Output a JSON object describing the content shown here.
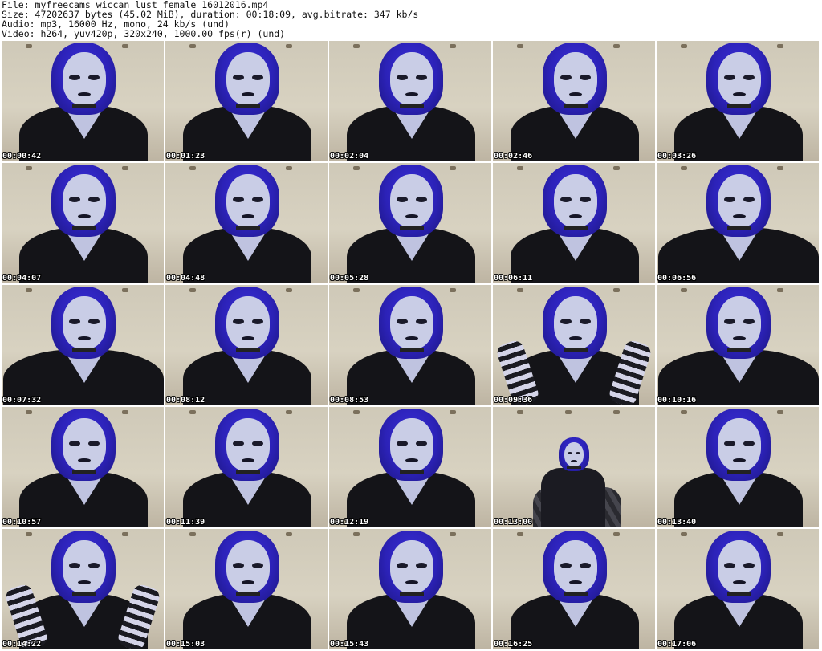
{
  "header": {
    "file_line": "File: myfreecams_wiccan_lust_female_16012016.mp4",
    "size_line": "Size: 47202637 bytes (45.02 MiB), duration: 00:18:09, avg.bitrate: 347 kb/s",
    "audio_line": "Audio: mp3, 16000 Hz, mono, 24 kb/s (und)",
    "video_line": "Video: h264, yuv420p, 320x240, 1000.00 fps(r) (und)"
  },
  "thumbnails": [
    {
      "timestamp": "00:00:42"
    },
    {
      "timestamp": "00:01:23"
    },
    {
      "timestamp": "00:02:04"
    },
    {
      "timestamp": "00:02:46"
    },
    {
      "timestamp": "00:03:26"
    },
    {
      "timestamp": "00:04:07"
    },
    {
      "timestamp": "00:04:48"
    },
    {
      "timestamp": "00:05:28"
    },
    {
      "timestamp": "00:06:11"
    },
    {
      "timestamp": "00:06:56"
    },
    {
      "timestamp": "00:07:32"
    },
    {
      "timestamp": "00:08:12"
    },
    {
      "timestamp": "00:08:53"
    },
    {
      "timestamp": "00:09:36"
    },
    {
      "timestamp": "00:10:16"
    },
    {
      "timestamp": "00:10:57"
    },
    {
      "timestamp": "00:11:39"
    },
    {
      "timestamp": "00:12:19"
    },
    {
      "timestamp": "00:13:00"
    },
    {
      "timestamp": "00:13:40"
    },
    {
      "timestamp": "00:14:22"
    },
    {
      "timestamp": "00:15:03"
    },
    {
      "timestamp": "00:15:43"
    },
    {
      "timestamp": "00:16:25"
    },
    {
      "timestamp": "00:17:06"
    }
  ],
  "colors": {
    "background": "#ffffff",
    "hair": "#2c22b8",
    "clothing": "#141418",
    "wall": "#d2ccbb",
    "timestamp_text": "#ffffff"
  }
}
